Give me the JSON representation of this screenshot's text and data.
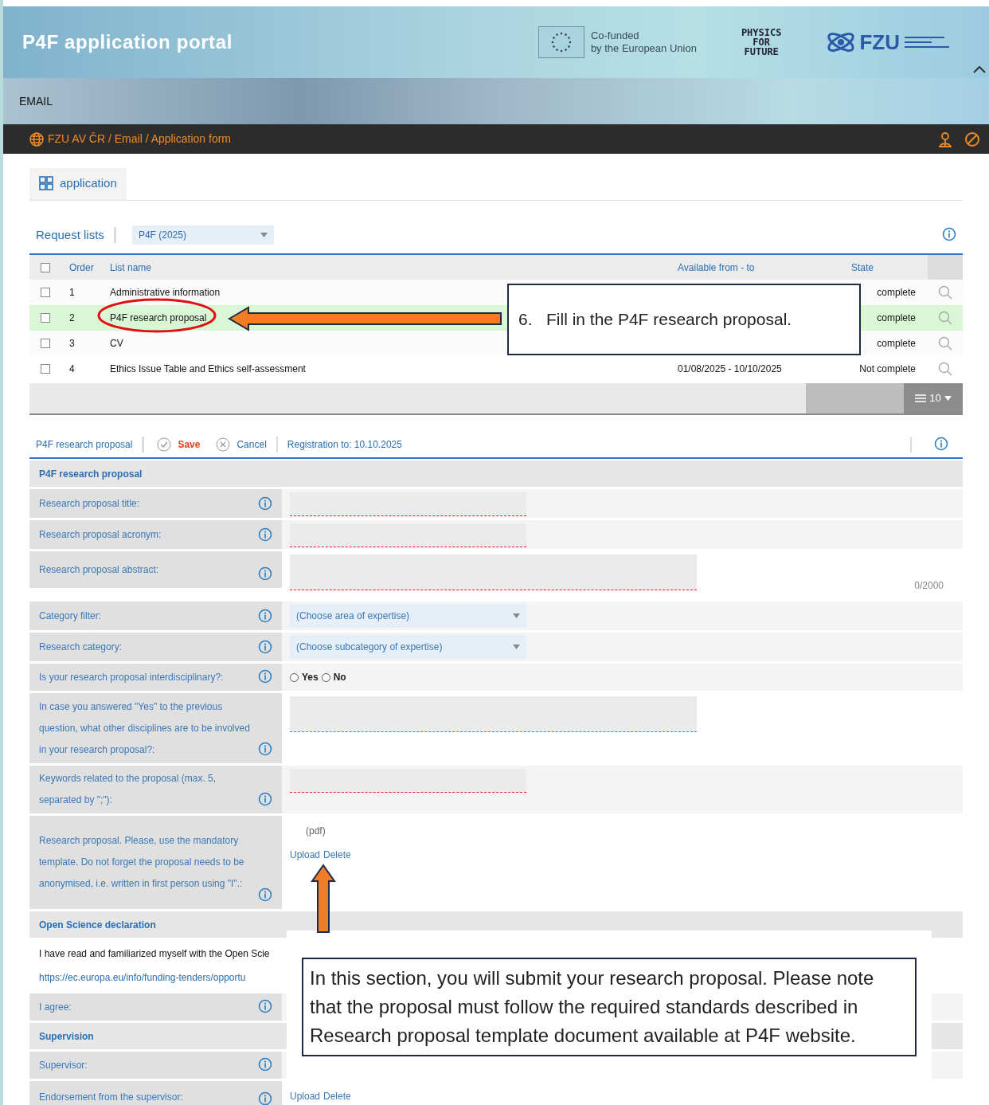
{
  "header": {
    "title": "P4F application portal",
    "eu_text": [
      "Co-funded",
      "by the European Union"
    ],
    "physics_logo": [
      "PHYSICS",
      "FOR",
      "FUTURE"
    ],
    "fzu_logo": "FZU"
  },
  "user_bar": {
    "user": "EMAIL"
  },
  "breadcrumb": "FZU AV ČR / Email / Application form",
  "tabs": [
    {
      "label": "application",
      "selected": true
    }
  ],
  "request_lists": {
    "label": "Request lists",
    "select": "P4F (2025)"
  },
  "table": {
    "select_all_checked": false,
    "columns": [
      "Order",
      "List name",
      "Available from - to",
      "State"
    ],
    "rows": [
      {
        "checked": false,
        "selected": false,
        "order": "1",
        "name": "Administrative information",
        "available": "",
        "state": "complete"
      },
      {
        "checked": false,
        "selected": true,
        "order": "2",
        "name": "P4F research proposal",
        "available": "",
        "state": "complete"
      },
      {
        "checked": false,
        "selected": false,
        "order": "3",
        "name": "CV",
        "available": "",
        "state": "complete"
      },
      {
        "checked": false,
        "selected": false,
        "order": "4",
        "name": "Ethics Issue Table and Ethics self-assessment",
        "available": "01/08/2025 - 10/10/2025",
        "state": "Not complete"
      }
    ],
    "page_size": "10"
  },
  "form_toolbar": {
    "title": "P4F research proposal",
    "save": "Save",
    "cancel": "Cancel",
    "registration": "Registration to: 10.10.2025"
  },
  "form_rows": [
    {
      "kind": "section",
      "label": "P4F research proposal"
    },
    {
      "kind": "text",
      "label": "Research proposal title:",
      "required": true
    },
    {
      "kind": "text",
      "label": "Research proposal acronym:",
      "required": true
    },
    {
      "kind": "textarea",
      "label": "Research proposal abstract:",
      "required": true,
      "counter": "0/2000"
    },
    {
      "kind": "select",
      "label": "Category filter:",
      "placeholder": "(Choose area of expertise)"
    },
    {
      "kind": "select",
      "label": "Research category:",
      "placeholder": "(Choose subcategory of expertise)"
    },
    {
      "kind": "radio",
      "label": "Is your research proposal interdisciplinary?:",
      "options": [
        {
          "label": "Yes",
          "checked": false
        },
        {
          "label": "No",
          "checked": false
        }
      ]
    },
    {
      "kind": "textarea",
      "label": "In case you answered \"Yes\" to the previous question, what other disciplines are to be involved in your research proposal?:",
      "required": false
    },
    {
      "kind": "text",
      "label": "Keywords related to the proposal (max. 5, separated by \";\"):",
      "required": true
    },
    {
      "kind": "upload",
      "label": "Research proposal. Please, use the mandatory template. Do not forget the proposal needs to be anonymised, i.e. written in first person using \"I\".:",
      "note": "(pdf)",
      "actions": [
        "Upload",
        "Delete"
      ]
    },
    {
      "kind": "section",
      "label": "Open Science declaration"
    },
    {
      "kind": "statement",
      "text": "I have read and familiarized myself with the Open Scie",
      "link": "https://ec.europa.eu/info/funding-tenders/opportu"
    },
    {
      "kind": "blank",
      "label": "I agree:"
    },
    {
      "kind": "section",
      "label": "Supervision"
    },
    {
      "kind": "blank",
      "label": "Supervisor:"
    },
    {
      "kind": "upload",
      "label": "Endorsement from the supervisor:",
      "actions": [
        "Upload",
        "Delete"
      ]
    }
  ],
  "annotations": [
    {
      "kind": "step",
      "text": "6.   Fill in the P4F research proposal."
    },
    {
      "kind": "note",
      "text": "In this section, you will submit your research proposal. Please note that the proposal must follow the required standards described in Research proposal template document available at P4F website."
    }
  ]
}
